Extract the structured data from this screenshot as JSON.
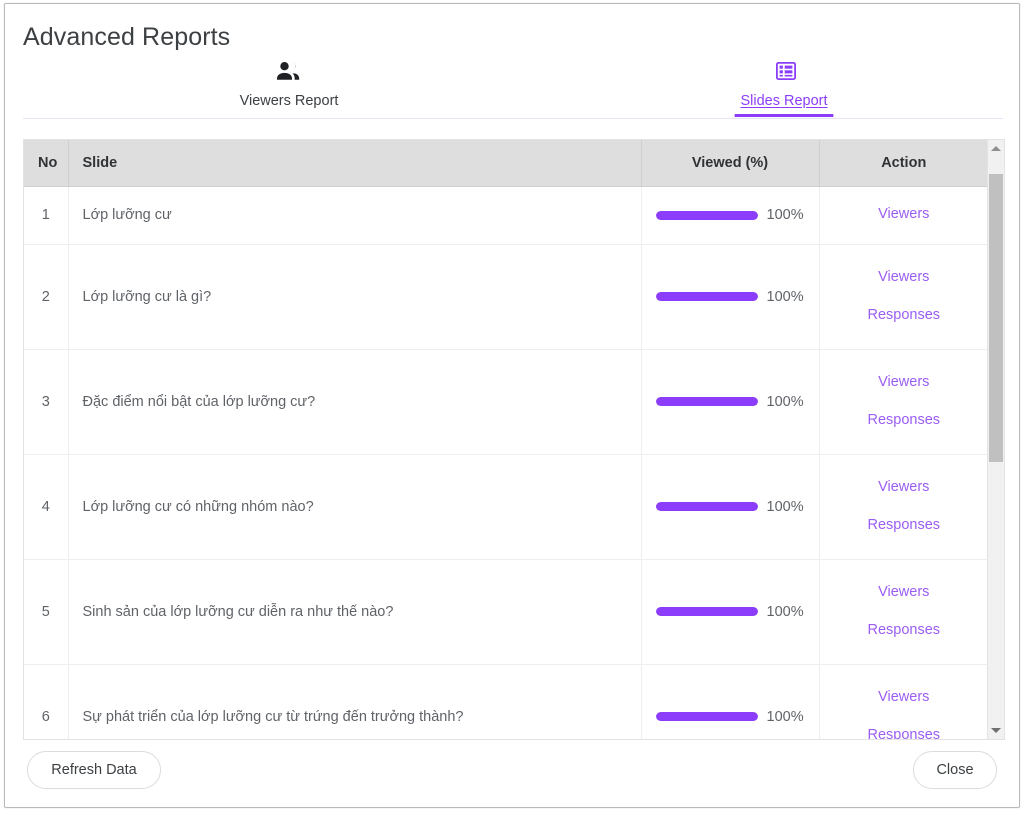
{
  "dialog": {
    "title": "Advanced Reports"
  },
  "tabs": [
    {
      "key": "viewers",
      "label": "Viewers Report",
      "icon": "people-icon",
      "active": false
    },
    {
      "key": "slides",
      "label": "Slides Report",
      "icon": "table-grid-icon",
      "active": true
    }
  ],
  "table": {
    "columns": {
      "no": "No",
      "slide": "Slide",
      "viewed": "Viewed (%)",
      "action": "Action"
    },
    "rows": [
      {
        "no": "1",
        "slide": "Lớp lưỡng cư",
        "viewed_pct": 100,
        "viewed_label": "100%",
        "actions": [
          "Viewers"
        ]
      },
      {
        "no": "2",
        "slide": "Lớp lưỡng cư là gì?",
        "viewed_pct": 100,
        "viewed_label": "100%",
        "actions": [
          "Viewers",
          "Responses"
        ]
      },
      {
        "no": "3",
        "slide": "Đặc điểm nổi bật của lớp lưỡng cư?",
        "viewed_pct": 100,
        "viewed_label": "100%",
        "actions": [
          "Viewers",
          "Responses"
        ]
      },
      {
        "no": "4",
        "slide": "Lớp lưỡng cư có những nhóm nào?",
        "viewed_pct": 100,
        "viewed_label": "100%",
        "actions": [
          "Viewers",
          "Responses"
        ]
      },
      {
        "no": "5",
        "slide": "Sinh sản của lớp lưỡng cư diễn ra như thế nào?",
        "viewed_pct": 100,
        "viewed_label": "100%",
        "actions": [
          "Viewers",
          "Responses"
        ]
      },
      {
        "no": "6",
        "slide": "Sự phát triển của lớp lưỡng cư từ trứng đến trưởng thành?",
        "viewed_pct": 100,
        "viewed_label": "100%",
        "actions": [
          "Viewers",
          "Responses"
        ]
      }
    ]
  },
  "scrollbar": {
    "up_icon": "chevron-up-icon",
    "down_icon": "chevron-down-icon",
    "thumb_top_pct": 3,
    "thumb_height_pct": 51
  },
  "footer": {
    "refresh_label": "Refresh Data",
    "close_label": "Close"
  },
  "colors": {
    "accent": "#8b3dfb",
    "link": "#9b5df3",
    "header_bg": "#dedede",
    "text": "#3c4043",
    "muted_text": "#5f6368"
  }
}
